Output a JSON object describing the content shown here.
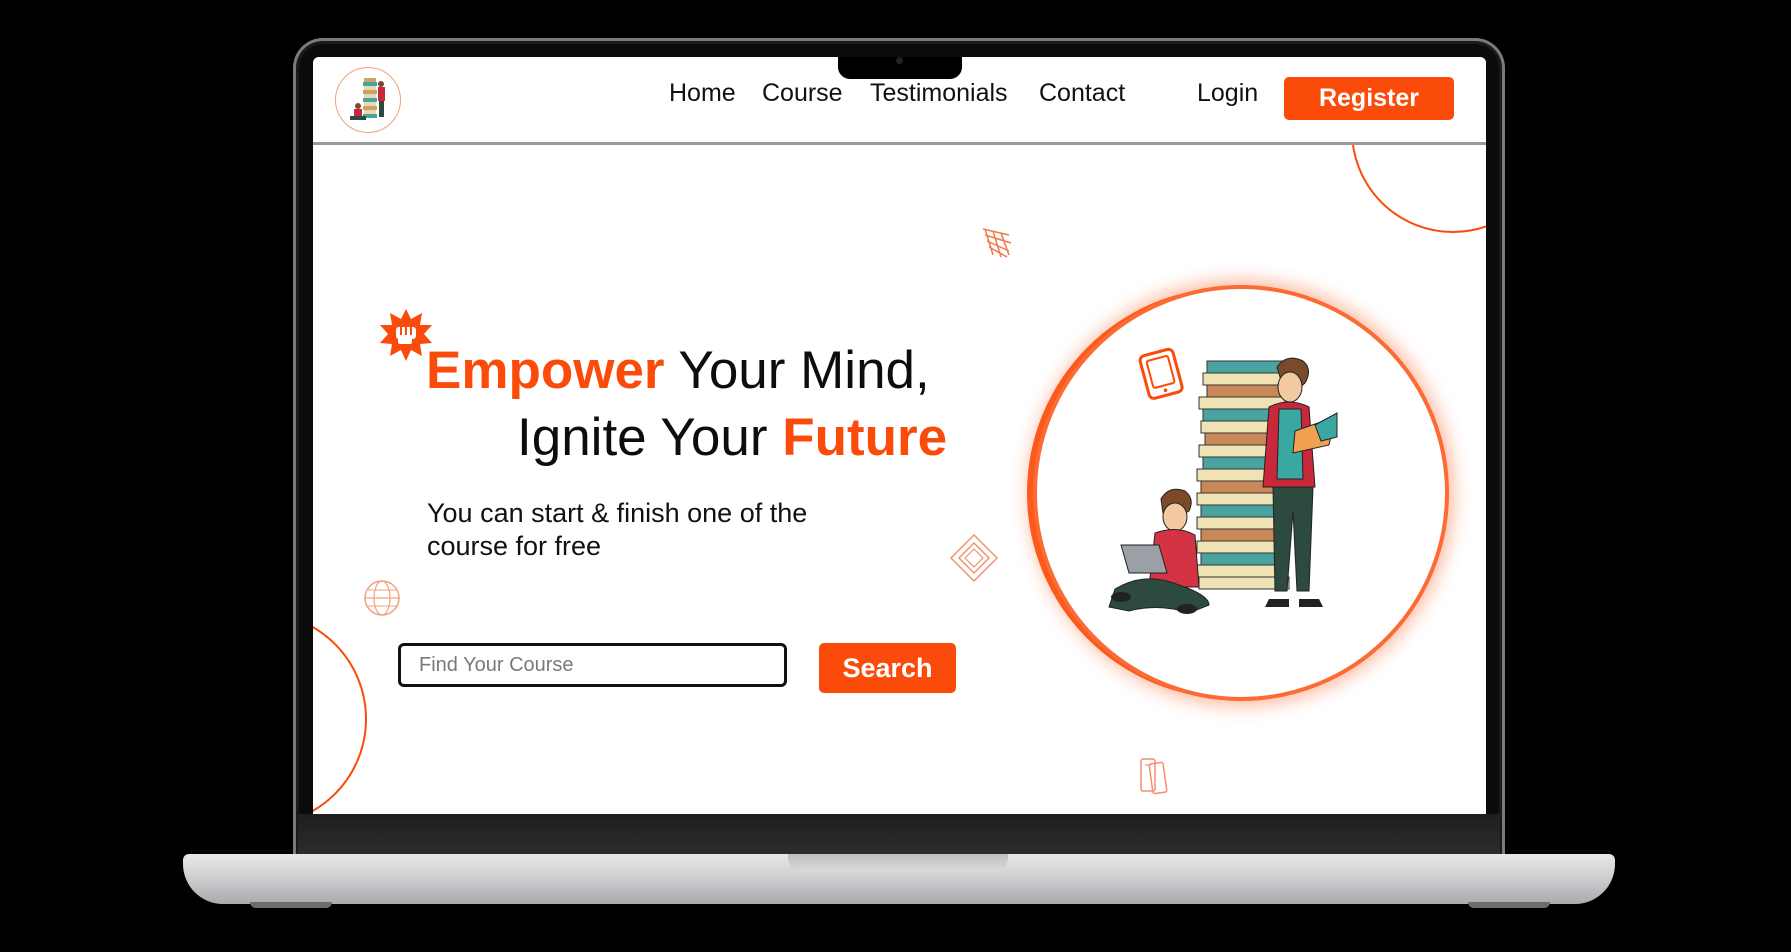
{
  "nav": {
    "home": "Home",
    "course": "Course",
    "testimonials": "Testimonials",
    "contact": "Contact",
    "login": "Login",
    "register": "Register"
  },
  "hero": {
    "title_line1_highlight": "Empower",
    "title_line1_rest": " Your Mind,",
    "title_line2_rest": "Ignite Your ",
    "title_line2_highlight": "Future",
    "subtitle": "You can start & finish one of the course for free"
  },
  "search": {
    "placeholder": "Find Your Course",
    "button_label": "Search"
  },
  "colors": {
    "accent": "#fb4b0a",
    "text": "#0d0d0d",
    "background": "#ffffff"
  },
  "icons": [
    "logo-icon",
    "fist-badge-icon",
    "doodle-icon",
    "globe-icon",
    "diamond-icon",
    "tablet-icon",
    "books-icon"
  ]
}
